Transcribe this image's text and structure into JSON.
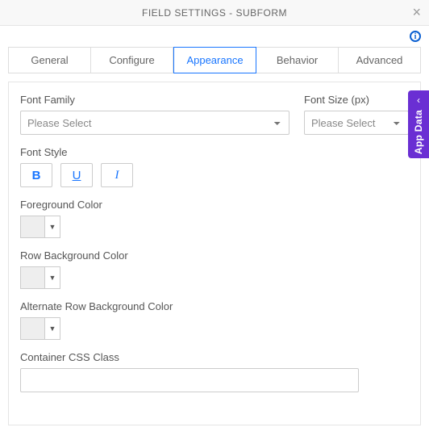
{
  "header": {
    "title": "FIELD SETTINGS - SUBFORM",
    "close": "×"
  },
  "info_icon": "i",
  "tabs": [
    {
      "label": "General",
      "active": false
    },
    {
      "label": "Configure",
      "active": false
    },
    {
      "label": "Appearance",
      "active": true
    },
    {
      "label": "Behavior",
      "active": false
    },
    {
      "label": "Advanced",
      "active": false
    }
  ],
  "form": {
    "font_family": {
      "label": "Font Family",
      "placeholder": "Please Select"
    },
    "font_size": {
      "label": "Font Size (px)",
      "placeholder": "Please Select"
    },
    "font_style": {
      "label": "Font Style",
      "bold": "B",
      "underline": "U",
      "italic": "I"
    },
    "foreground_color": {
      "label": "Foreground Color"
    },
    "row_bg_color": {
      "label": "Row Background Color"
    },
    "alt_row_bg_color": {
      "label": "Alternate Row Background Color"
    },
    "container_css_class": {
      "label": "Container CSS Class",
      "value": ""
    }
  },
  "side_tab": {
    "label": "App Data",
    "chevron": "‹"
  }
}
